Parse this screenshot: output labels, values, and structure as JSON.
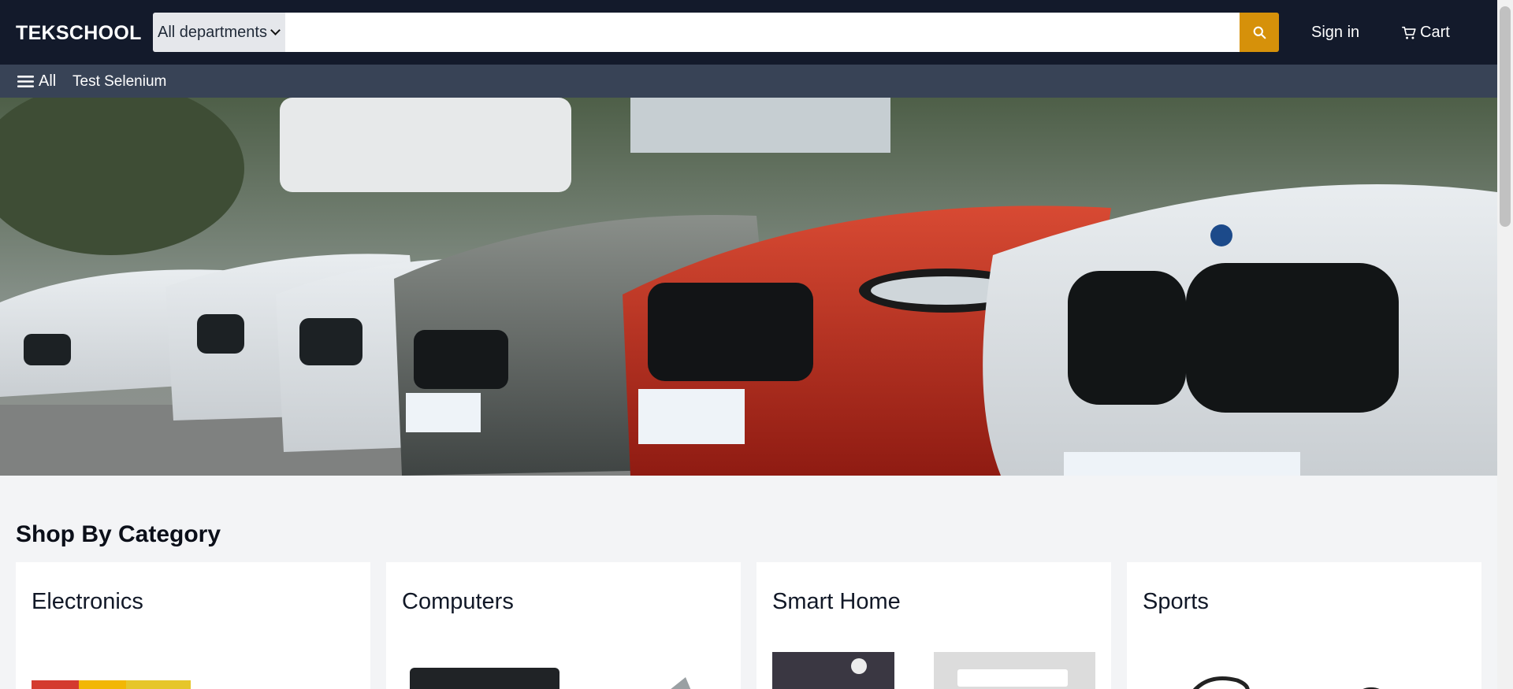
{
  "header": {
    "logo": "TEKSCHOOL",
    "department": "All departments",
    "search_placeholder": "",
    "signin": "Sign in",
    "cart": "Cart"
  },
  "subnav": {
    "all": "All",
    "link": "Test Selenium"
  },
  "category_section": {
    "title": "Shop By Category",
    "cards": [
      {
        "label": "Electronics"
      },
      {
        "label": "Computers"
      },
      {
        "label": "Smart Home"
      },
      {
        "label": "Sports"
      }
    ]
  },
  "colors": {
    "header_bg": "#131a2b",
    "subnav_bg": "#384356",
    "accent": "#d6910a",
    "page_bg": "#f3f4f6"
  },
  "icons": {
    "search": "search-icon",
    "cart": "cart-icon",
    "menu": "menu-icon"
  }
}
